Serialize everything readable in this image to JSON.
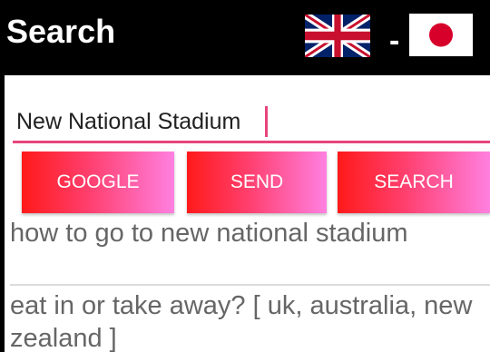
{
  "header": {
    "title": "Search",
    "flag_separator": "-",
    "flags": [
      {
        "icon": "uk-flag-icon"
      },
      {
        "icon": "japan-flag-icon"
      }
    ]
  },
  "search": {
    "value": "New National Stadium",
    "accent_color": "#e8457c"
  },
  "buttons": {
    "google_label": "GOOGLE",
    "send_label": "SEND",
    "search_label": "SEARCH"
  },
  "results": [
    {
      "text": "how to go to new national stadium"
    },
    {
      "text": "eat in or take away? [ uk, australia, new zealand ]"
    }
  ],
  "colors": {
    "header_bg": "#000000",
    "button_gradient_start": "#ff1a1a",
    "button_gradient_end": "#ff80e0"
  }
}
